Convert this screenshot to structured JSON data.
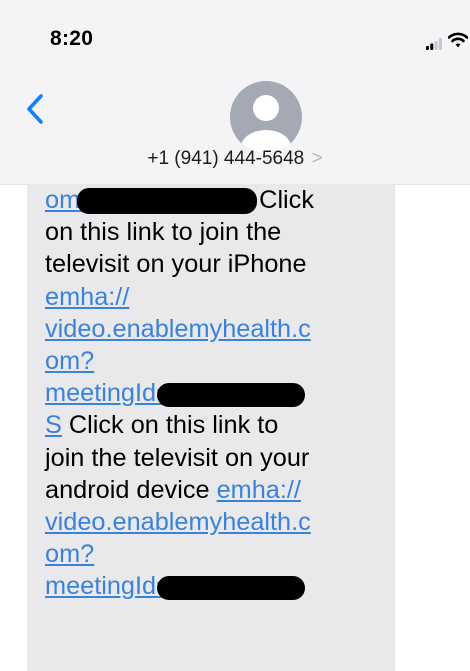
{
  "status_bar": {
    "time": "8:20"
  },
  "header": {
    "contact_number": "+1 (941) 444-5648",
    "chevron": ">"
  },
  "message": {
    "lines": [
      {
        "segments": [
          {
            "text": "om/",
            "link": true
          },
          {
            "redacted": true,
            "size": "rd1"
          },
          {
            "text": "Click",
            "link": false
          }
        ]
      },
      {
        "segments": [
          {
            "text": "on this link to join the",
            "link": false
          }
        ]
      },
      {
        "segments": [
          {
            "text": "televisit on your iPhone",
            "link": false
          }
        ]
      },
      {
        "segments": [
          {
            "text": "emha://",
            "link": true
          }
        ]
      },
      {
        "segments": [
          {
            "text": "video.enablemyhealth.c",
            "link": true
          }
        ]
      },
      {
        "segments": [
          {
            "text": "om?",
            "link": true
          }
        ]
      },
      {
        "segments": [
          {
            "text": "meetingId=",
            "link": true
          },
          {
            "redacted": true,
            "size": "rd2"
          }
        ]
      },
      {
        "segments": [
          {
            "text": "S",
            "link": true
          },
          {
            "text": " Click on this link to",
            "link": false
          }
        ]
      },
      {
        "segments": [
          {
            "text": "join the televisit on your",
            "link": false
          }
        ]
      },
      {
        "segments": [
          {
            "text": "android device ",
            "link": false
          },
          {
            "text": "emha://",
            "link": true
          }
        ]
      },
      {
        "segments": [
          {
            "text": "video.enablemyhealth.c",
            "link": true
          }
        ]
      },
      {
        "segments": [
          {
            "text": "om?",
            "link": true
          }
        ]
      },
      {
        "segments": [
          {
            "text": "meetingId=",
            "link": true
          },
          {
            "redacted": true,
            "size": "rd3"
          }
        ]
      }
    ]
  },
  "colors": {
    "header_bg": "#f4f4f6",
    "bubble_bg": "#e9e9eb",
    "link": "#3b82d9",
    "ios_blue": "#147efb",
    "avatar_bg": "#a5a9b3"
  },
  "icons": [
    "signal-icon",
    "wifi-icon",
    "back-chevron-icon",
    "contact-avatar-icon"
  ]
}
